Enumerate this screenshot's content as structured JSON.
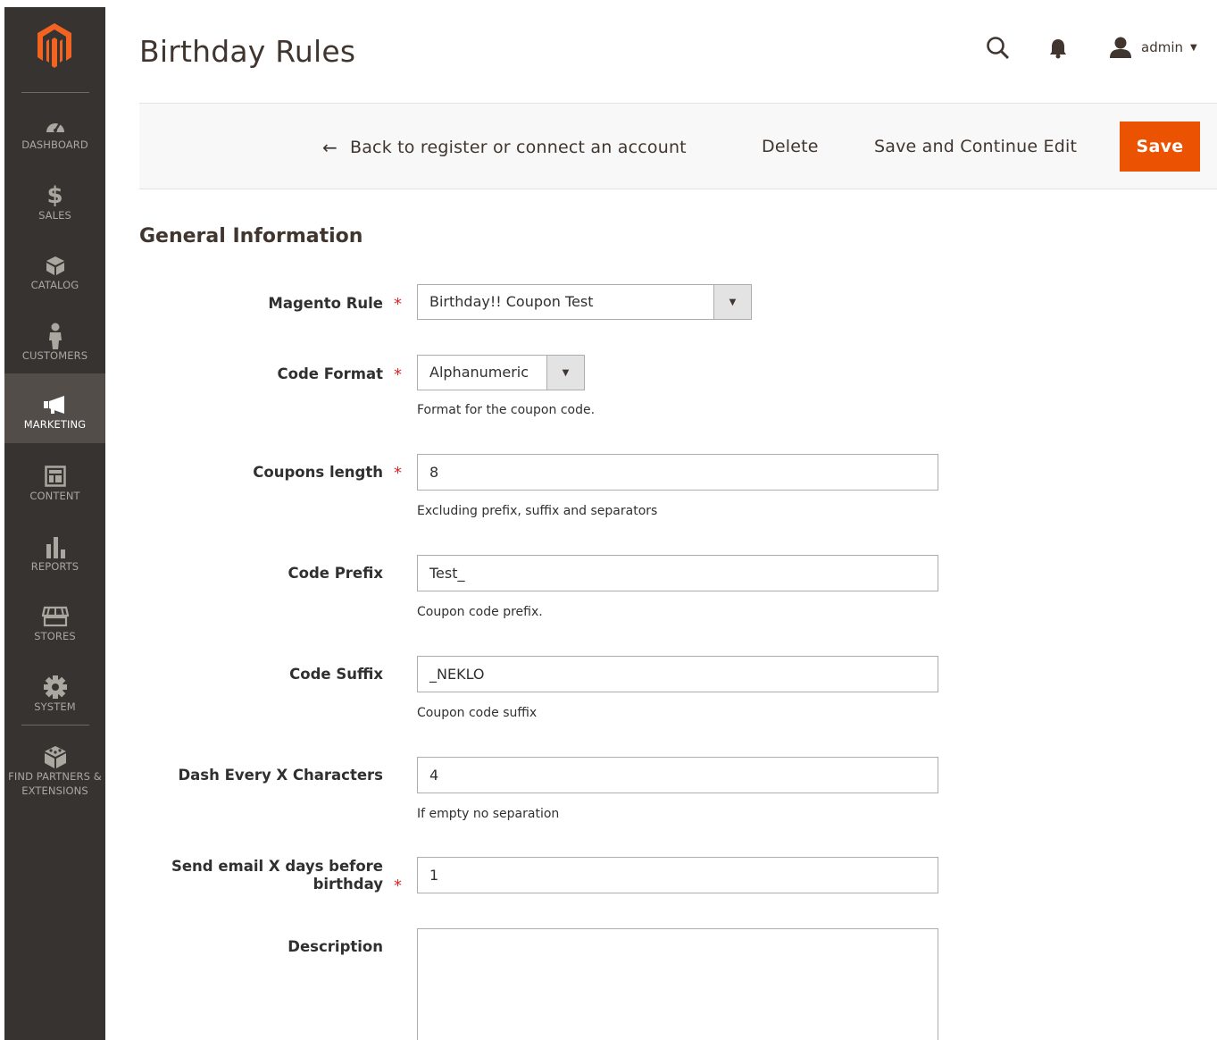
{
  "sidebar": {
    "items": [
      {
        "label": "DASHBOARD",
        "icon": "dashboard-icon"
      },
      {
        "label": "SALES",
        "icon": "dollar-icon"
      },
      {
        "label": "CATALOG",
        "icon": "box-icon"
      },
      {
        "label": "CUSTOMERS",
        "icon": "person-icon"
      },
      {
        "label": "MARKETING",
        "icon": "megaphone-icon",
        "active": true
      },
      {
        "label": "CONTENT",
        "icon": "layout-icon"
      },
      {
        "label": "REPORTS",
        "icon": "bar-chart-icon"
      },
      {
        "label": "STORES",
        "icon": "store-icon"
      },
      {
        "label": "SYSTEM",
        "icon": "gear-icon"
      },
      {
        "label": "FIND PARTNERS & EXTENSIONS",
        "icon": "cube-icon"
      }
    ]
  },
  "header": {
    "title": "Birthday Rules",
    "user": "admin"
  },
  "actions": {
    "back": "Back to register or connect an account",
    "delete": "Delete",
    "save_continue": "Save and Continue Edit",
    "save": "Save"
  },
  "section": {
    "title": "General Information"
  },
  "form": {
    "magento_rule": {
      "label": "Magento Rule",
      "value": "Birthday!! Coupon Test"
    },
    "code_format": {
      "label": "Code Format",
      "value": "Alphanumeric",
      "note": "Format for the coupon code."
    },
    "coupons_length": {
      "label": "Coupons length",
      "value": "8",
      "note": "Excluding prefix, suffix and separators"
    },
    "code_prefix": {
      "label": "Code Prefix",
      "value": "Test_",
      "note": "Coupon code prefix."
    },
    "code_suffix": {
      "label": "Code Suffix",
      "value": "_NEKLO",
      "note": "Coupon code suffix"
    },
    "dash_every": {
      "label": "Dash Every X Characters",
      "value": "4",
      "note": "If empty no separation"
    },
    "send_email_line1": "Send email X days before",
    "send_email_line2": "birthday",
    "send_email_value": "1",
    "description": {
      "label": "Description",
      "value": ""
    }
  },
  "colors": {
    "sidebar_bg": "#373330",
    "sidebar_active": "#524d49",
    "accent": "#eb5202",
    "required": "#e22626"
  }
}
